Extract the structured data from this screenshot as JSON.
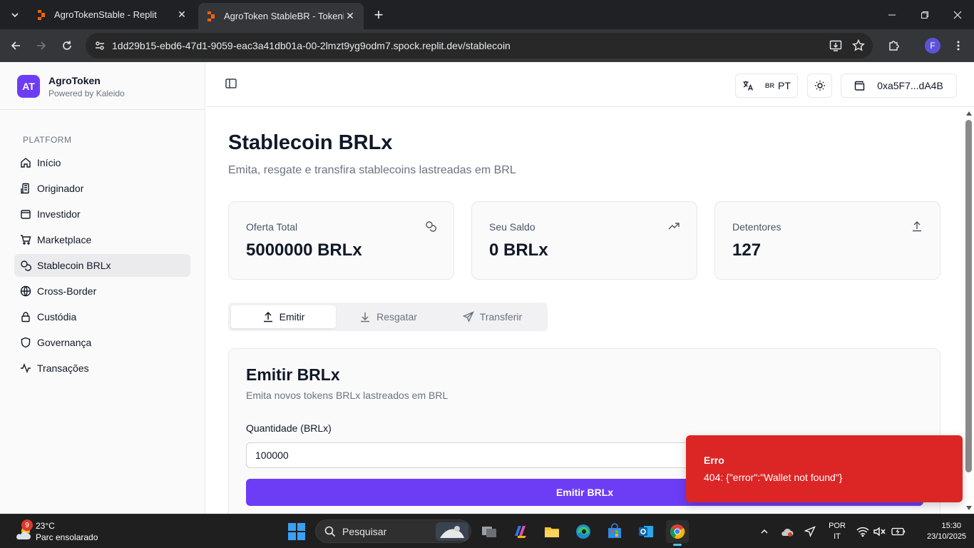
{
  "browser": {
    "tabs": [
      {
        "title": "AgroTokenStable - Replit",
        "active": false
      },
      {
        "title": "AgroToken StableBR - Tokenização",
        "active": true
      }
    ],
    "url_host": "1dd29b15-ebd6-47d1-9059-eac3a41db01a-00-2lmzt9yg9odm7.spock.replit.dev",
    "url_path": "/stablecoin",
    "profile_initial": "F"
  },
  "sidebar": {
    "brand_logo": "AT",
    "brand_name": "AgroToken",
    "brand_sub": "Powered by Kaleido",
    "group_label": "PLATFORM",
    "items": [
      {
        "label": "Início",
        "icon": "home-icon"
      },
      {
        "label": "Originador",
        "icon": "building-icon"
      },
      {
        "label": "Investidor",
        "icon": "wallet-icon"
      },
      {
        "label": "Marketplace",
        "icon": "cart-icon"
      },
      {
        "label": "Stablecoin BRLx",
        "icon": "coins-icon",
        "active": true
      },
      {
        "label": "Cross-Border",
        "icon": "globe-icon"
      },
      {
        "label": "Custódia",
        "icon": "lock-icon"
      },
      {
        "label": "Governança",
        "icon": "shield-icon"
      },
      {
        "label": "Transações",
        "icon": "activity-icon"
      }
    ]
  },
  "topbar": {
    "lang_flag": "BR",
    "lang_code": "PT",
    "wallet_address": "0xa5F7...dA4B"
  },
  "page": {
    "title": "Stablecoin BRLx",
    "subtitle": "Emita, resgate e transfira stablecoins lastreadas em BRL",
    "stats": [
      {
        "label": "Oferta Total",
        "value": "5000000 BRLx",
        "icon": "coins-icon"
      },
      {
        "label": "Seu Saldo",
        "value": "0 BRLx",
        "icon": "trending-up-icon"
      },
      {
        "label": "Detentores",
        "value": "127",
        "icon": "upload-icon"
      }
    ],
    "tabs": [
      {
        "label": "Emitir",
        "icon": "upload-icon",
        "selected": true
      },
      {
        "label": "Resgatar",
        "icon": "download-icon",
        "selected": false
      },
      {
        "label": "Transferir",
        "icon": "send-icon",
        "selected": false
      }
    ],
    "form": {
      "title": "Emitir BRLx",
      "subtitle": "Emita novos tokens BRLx lastreados em BRL",
      "amount_label": "Quantidade (BRLx)",
      "amount_value": "100000",
      "submit_label": "Emitir BRLx"
    }
  },
  "toast": {
    "title": "Erro",
    "message": "404: {\"error\":\"Wallet not found\"}",
    "color": "#dc2626"
  },
  "taskbar": {
    "weather_badge": "9",
    "weather_temp": "23°C",
    "weather_desc": "Parc ensolarado",
    "search_placeholder": "Pesquisar",
    "lang_line1": "POR",
    "lang_line2": "IT",
    "time": "15:30",
    "date": "23/10/2025"
  },
  "colors": {
    "accent": "#6d3df5",
    "error": "#dc2626"
  }
}
